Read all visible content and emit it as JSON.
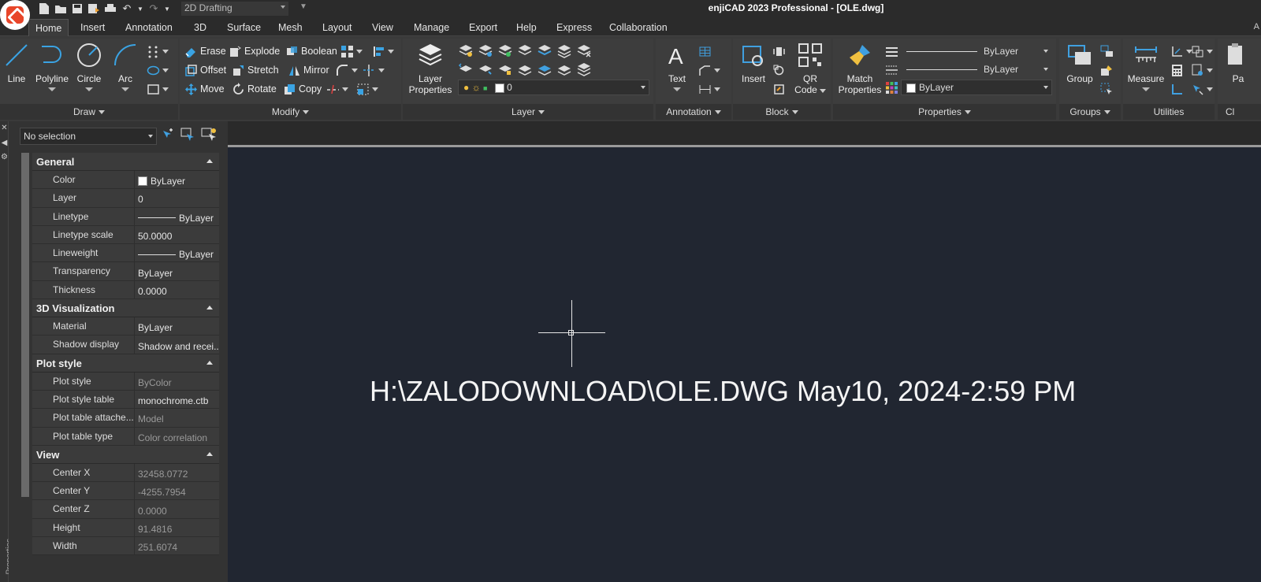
{
  "window": {
    "title": "enjiCAD 2023 Professional - [OLE.dwg]",
    "workspace": "2D Drafting"
  },
  "menu": {
    "tabs": [
      "Home",
      "Insert",
      "Annotation",
      "3D",
      "Surface",
      "Mesh",
      "Layout",
      "View",
      "Manage",
      "Export",
      "Help",
      "Express",
      "Collaboration"
    ],
    "active": "Home"
  },
  "ribbon": {
    "draw": {
      "title": "Draw",
      "line": "Line",
      "polyline": "Polyline",
      "circle": "Circle",
      "arc": "Arc"
    },
    "modify": {
      "title": "Modify",
      "erase": "Erase",
      "explode": "Explode",
      "boolean": "Boolean",
      "offset": "Offset",
      "stretch": "Stretch",
      "mirror": "Mirror",
      "move": "Move",
      "rotate": "Rotate",
      "copy": "Copy"
    },
    "layer": {
      "title": "Layer",
      "properties_line1": "Layer",
      "properties_line2": "Properties",
      "current": "0"
    },
    "annotation": {
      "title": "Annotation",
      "text": "Text"
    },
    "block": {
      "title": "Block",
      "insert": "Insert",
      "qr_line1": "QR",
      "qr_line2": "Code"
    },
    "properties": {
      "title": "Properties",
      "match_line1": "Match",
      "match_line2": "Properties",
      "linetype": "ByLayer",
      "lineweight": "ByLayer",
      "color": "ByLayer"
    },
    "groups": {
      "title": "Groups",
      "group": "Group"
    },
    "utilities": {
      "title": "Utilities",
      "measure": "Measure"
    },
    "clipboard": {
      "title": "Cl",
      "paste": "Pa"
    }
  },
  "properties_panel": {
    "selection": "No selection",
    "side_label": "Properties",
    "sections": [
      {
        "title": "General",
        "rows": [
          {
            "key": "Color",
            "value": "ByLayer",
            "swatch": true
          },
          {
            "key": "Layer",
            "value": "0"
          },
          {
            "key": "Linetype",
            "value": "ByLayer",
            "line": true
          },
          {
            "key": "Linetype scale",
            "value": "50.0000"
          },
          {
            "key": "Lineweight",
            "value": "ByLayer",
            "line": true
          },
          {
            "key": "Transparency",
            "value": "ByLayer"
          },
          {
            "key": "Thickness",
            "value": "0.0000"
          }
        ]
      },
      {
        "title": "3D Visualization",
        "rows": [
          {
            "key": "Material",
            "value": "ByLayer"
          },
          {
            "key": "Shadow display",
            "value": "Shadow and recei..."
          }
        ]
      },
      {
        "title": "Plot style",
        "rows": [
          {
            "key": "Plot style",
            "value": "ByColor",
            "dim": true
          },
          {
            "key": "Plot style table",
            "value": "monochrome.ctb"
          },
          {
            "key": "Plot table attache...",
            "value": "Model",
            "dim": true
          },
          {
            "key": "Plot table type",
            "value": "Color correlation",
            "dim": true
          }
        ]
      },
      {
        "title": "View",
        "rows": [
          {
            "key": "Center X",
            "value": "32458.0772",
            "dim": true
          },
          {
            "key": "Center Y",
            "value": "-4255.7954",
            "dim": true
          },
          {
            "key": "Center Z",
            "value": "0.0000",
            "dim": true
          },
          {
            "key": "Height",
            "value": "91.4816",
            "dim": true
          },
          {
            "key": "Width",
            "value": "251.6074",
            "dim": true
          }
        ]
      }
    ]
  },
  "drawing": {
    "text": "H:\\ZALODOWNLOAD\\OLE.DWG May10, 2024-2:59 PM"
  },
  "colors": {
    "canvas": "#212631",
    "ribbon": "#3a3a3a",
    "panel": "#333333",
    "accent_blue": "#3aa3e3"
  }
}
